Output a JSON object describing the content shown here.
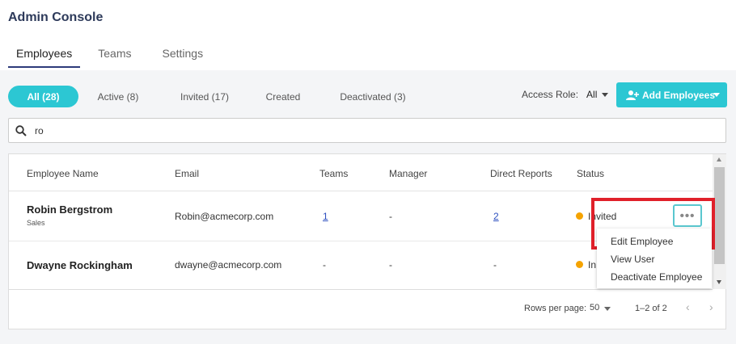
{
  "app_title": "Admin Console",
  "tabs": [
    {
      "label": "Employees"
    },
    {
      "label": "Teams"
    },
    {
      "label": "Settings"
    }
  ],
  "filters": [
    {
      "label": "All (28)"
    },
    {
      "label": "Active (8)"
    },
    {
      "label": "Invited (17)"
    },
    {
      "label": "Created"
    },
    {
      "label": "Deactivated (3)"
    }
  ],
  "access_role": {
    "label": "Access Role:",
    "value": "All"
  },
  "add_button": {
    "label": "Add Employees"
  },
  "search": {
    "value": "ro"
  },
  "table": {
    "columns": [
      "Employee Name",
      "Email",
      "Teams",
      "Manager",
      "Direct Reports",
      "Status"
    ],
    "rows": [
      {
        "name": "Robin Bergstrom",
        "department": "Sales",
        "email": "Robin@acmecorp.com",
        "teams": "1",
        "manager": "-",
        "direct_reports": "2",
        "status": "Invited"
      },
      {
        "name": "Dwayne Rockingham",
        "department": "",
        "email": "dwayne@acmecorp.com",
        "teams": "-",
        "manager": "-",
        "direct_reports": "-",
        "status": "In"
      }
    ]
  },
  "more_button": {
    "label": "•••"
  },
  "menu": [
    {
      "label": "Edit Employee"
    },
    {
      "label": "View User"
    },
    {
      "label": "Deactivate Employee"
    }
  ],
  "pagination": {
    "rows_label": "Rows per page:",
    "rows_value": "50",
    "range": "1–2 of 2",
    "prev": "‹",
    "next": "›"
  },
  "colors": {
    "accent": "#2cc7d3",
    "highlight": "#e0202a",
    "status_invited": "#f5a300"
  }
}
